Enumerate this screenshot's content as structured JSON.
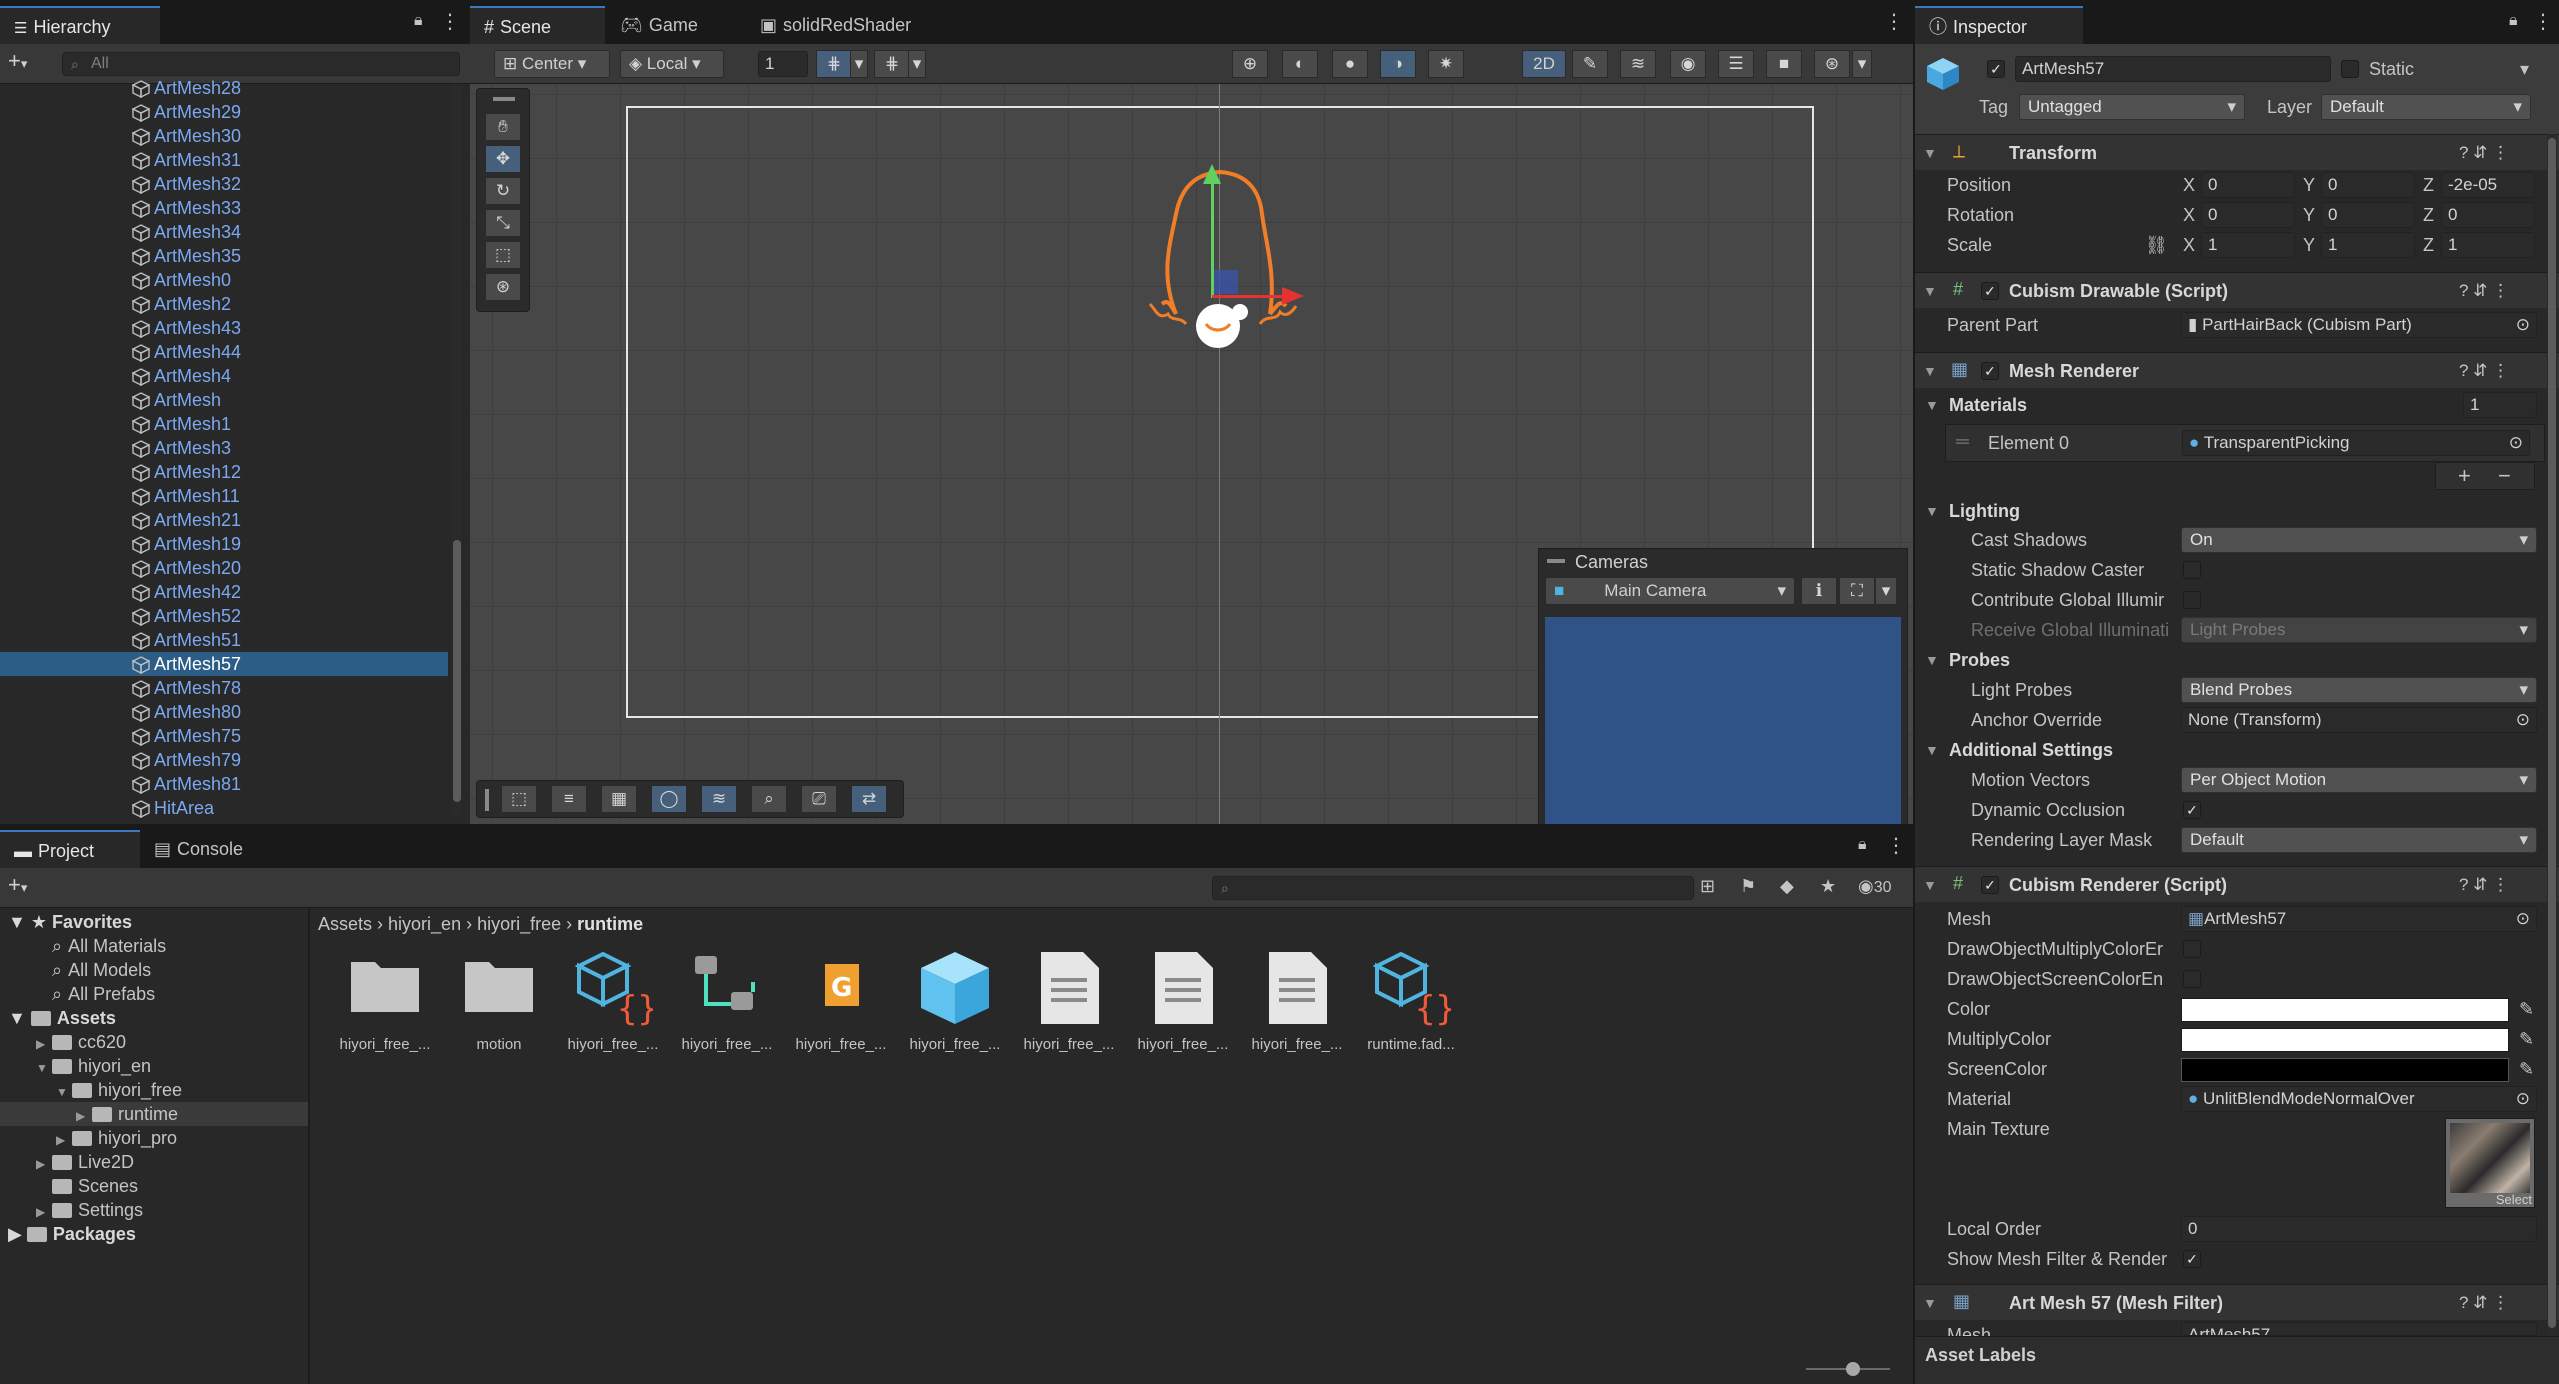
{
  "hierarchy": {
    "tab_label": "Hierarchy",
    "search_placeholder": "All",
    "items": [
      "ArtMesh28",
      "ArtMesh29",
      "ArtMesh30",
      "ArtMesh31",
      "ArtMesh32",
      "ArtMesh33",
      "ArtMesh34",
      "ArtMesh35",
      "ArtMesh0",
      "ArtMesh2",
      "ArtMesh43",
      "ArtMesh44",
      "ArtMesh4",
      "ArtMesh",
      "ArtMesh1",
      "ArtMesh3",
      "ArtMesh12",
      "ArtMesh11",
      "ArtMesh21",
      "ArtMesh19",
      "ArtMesh20",
      "ArtMesh42",
      "ArtMesh52",
      "ArtMesh51",
      "ArtMesh57",
      "ArtMesh78",
      "ArtMesh80",
      "ArtMesh75",
      "ArtMesh79",
      "ArtMesh81",
      "HitArea"
    ],
    "selected": "ArtMesh57"
  },
  "scene": {
    "tabs": [
      "Scene",
      "Game",
      "solidRedShader"
    ],
    "active_tab": "Scene",
    "pivot_label": "Center",
    "space_label": "Local",
    "grid_snap_value": "1",
    "mode_2d_label": "2D",
    "cameras_overlay": {
      "title": "Cameras",
      "camera": "Main Camera"
    }
  },
  "inspector": {
    "tab_label": "Inspector",
    "object_name": "ArtMesh57",
    "static_label": "Static",
    "tag_label": "Tag",
    "tag_value": "Untagged",
    "layer_label": "Layer",
    "layer_value": "Default",
    "transform": {
      "title": "Transform",
      "position_label": "Position",
      "position": {
        "x": "0",
        "y": "0",
        "z": "-2e-05"
      },
      "rotation_label": "Rotation",
      "rotation": {
        "x": "0",
        "y": "0",
        "z": "0"
      },
      "scale_label": "Scale",
      "scale": {
        "x": "1",
        "y": "1",
        "z": "1"
      }
    },
    "cubism_drawable": {
      "title": "Cubism Drawable (Script)",
      "parent_part_label": "Parent Part",
      "parent_part_value": "PartHairBack (Cubism Part)"
    },
    "mesh_renderer": {
      "title": "Mesh Renderer",
      "materials_label": "Materials",
      "materials_count": "1",
      "element0_label": "Element 0",
      "element0_value": "TransparentPicking",
      "lighting_label": "Lighting",
      "cast_shadows_label": "Cast Shadows",
      "cast_shadows_value": "On",
      "static_shadow_label": "Static Shadow Caster",
      "contribute_gi_label": "Contribute Global Illumir",
      "receive_gi_label": "Receive Global Illuminati",
      "receive_gi_value": "Light Probes",
      "probes_label": "Probes",
      "light_probes_label": "Light Probes",
      "light_probes_value": "Blend Probes",
      "anchor_override_label": "Anchor Override",
      "anchor_override_value": "None (Transform)",
      "additional_label": "Additional Settings",
      "motion_vectors_label": "Motion Vectors",
      "motion_vectors_value": "Per Object Motion",
      "dynamic_occlusion_label": "Dynamic Occlusion",
      "rendering_layer_label": "Rendering Layer Mask",
      "rendering_layer_value": "Default"
    },
    "cubism_renderer": {
      "title": "Cubism Renderer (Script)",
      "mesh_label": "Mesh",
      "mesh_value": "ArtMesh57",
      "multiply_label": "DrawObjectMultiplyColorEr",
      "screen_label": "DrawObjectScreenColorEn",
      "color_label": "Color",
      "color_value": "#ffffff",
      "multiply_color_label": "MultiplyColor",
      "multiply_color_value": "#ffffff",
      "screen_color_label": "ScreenColor",
      "screen_color_value": "#000000",
      "material_label": "Material",
      "material_value": "UnlitBlendModeNormalOver",
      "main_texture_label": "Main Texture",
      "select_label": "Select",
      "local_order_label": "Local Order",
      "local_order_value": "0",
      "show_mesh_label": "Show Mesh Filter & Render"
    },
    "mesh_filter": {
      "title": "Art Mesh 57 (Mesh Filter)",
      "mesh_label": "Mesh",
      "mesh_value": "ArtMesh57"
    },
    "asset_labels": "Asset Labels"
  },
  "project": {
    "tabs": [
      "Project",
      "Console"
    ],
    "favorites_label": "Favorites",
    "favorites": [
      "All Materials",
      "All Models",
      "All Prefabs"
    ],
    "assets_label": "Assets",
    "folders": [
      "cc620",
      "hiyori_en",
      "hiyori_free",
      "runtime",
      "hiyori_pro",
      "Live2D",
      "Scenes",
      "Settings"
    ],
    "packages_label": "Packages",
    "breadcrumb": [
      "Assets",
      "hiyori_en",
      "hiyori_free",
      "runtime"
    ],
    "visible_count": "30",
    "assets": [
      {
        "name": "hiyori_free_...",
        "icon": "folder-icon"
      },
      {
        "name": "motion",
        "icon": "folder-icon"
      },
      {
        "name": "hiyori_free_...",
        "icon": "script-cube-icon"
      },
      {
        "name": "hiyori_free_...",
        "icon": "animator-controller-icon"
      },
      {
        "name": "hiyori_free_...",
        "icon": "texture-g-icon"
      },
      {
        "name": "hiyori_free_...",
        "icon": "prefab-cube-icon"
      },
      {
        "name": "hiyori_free_...",
        "icon": "text-document-icon"
      },
      {
        "name": "hiyori_free_...",
        "icon": "text-document-icon"
      },
      {
        "name": "hiyori_free_...",
        "icon": "text-document-icon"
      },
      {
        "name": "runtime.fad...",
        "icon": "script-cube-icon"
      }
    ]
  },
  "colors": {
    "accent": "#3a79bb",
    "selection": "#2c5d87",
    "hair_outline": "#f07d28",
    "camera_preview": "#2f5387"
  }
}
